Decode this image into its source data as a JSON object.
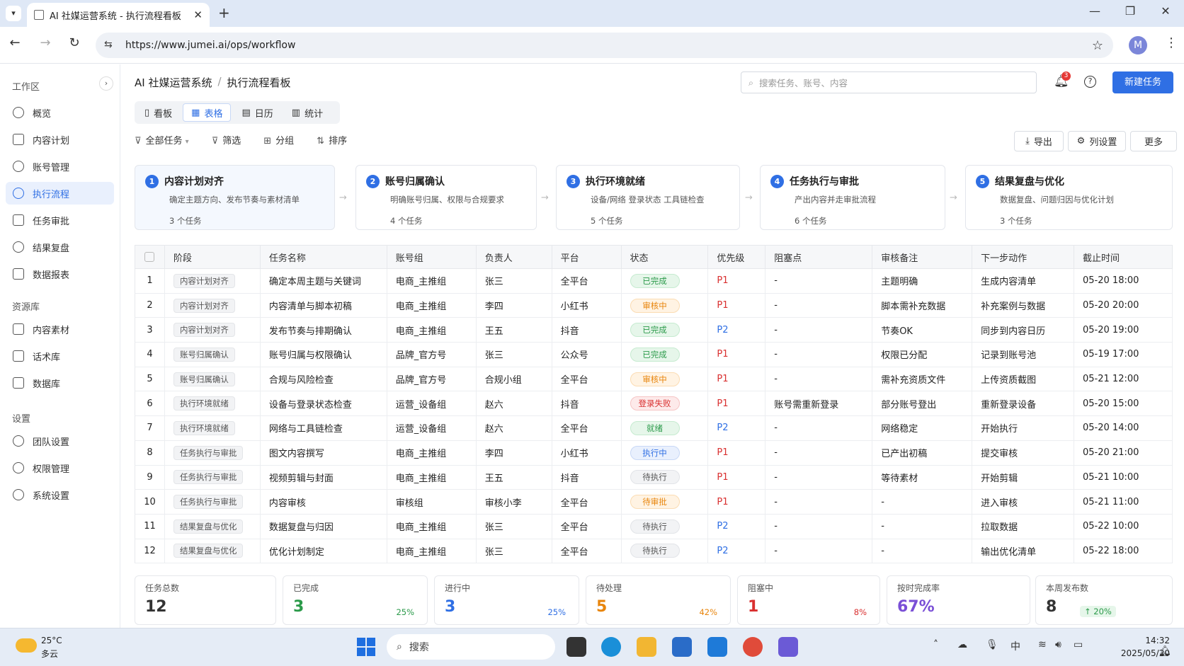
{
  "browser": {
    "tab_title": "AI 社媒运营系统 - 执行流程看板",
    "url": "https://www.jumei.ai/ops/workflow",
    "avatar_letter": "M"
  },
  "sidebar": {
    "workspace_label": "工作区",
    "workspace_items": [
      "概览",
      "内容计划",
      "账号管理",
      "执行流程",
      "任务审批",
      "结果复盘",
      "数据报表"
    ],
    "active_item": "执行流程",
    "library_label": "资源库",
    "library_items": [
      "内容素材",
      "话术库",
      "数据库"
    ],
    "settings_label": "设置",
    "settings_items": [
      "团队设置",
      "权限管理",
      "系统设置"
    ]
  },
  "header": {
    "breadcrumb_root": "AI 社媒运营系统",
    "breadcrumb_sep": "/",
    "breadcrumb_current": "执行流程看板",
    "search_placeholder": "搜索任务、账号、内容",
    "notification_count": "3",
    "new_task_label": "新建任务"
  },
  "view_tabs": [
    "看板",
    "表格",
    "日历",
    "统计"
  ],
  "active_view": "表格",
  "toolbar": {
    "filter_all": "全部任务",
    "filter": "筛选",
    "group": "分组",
    "sort": "排序",
    "export": "导出",
    "column_settings": "列设置",
    "more": "更多"
  },
  "stages": [
    {
      "num": "1",
      "title": "内容计划对齐",
      "desc": "确定主题方向、发布节奏与素材清单",
      "count": "3 个任务"
    },
    {
      "num": "2",
      "title": "账号归属确认",
      "desc": "明确账号归属、权限与合规要求",
      "count": "4 个任务"
    },
    {
      "num": "3",
      "title": "执行环境就绪",
      "desc": "设备/网络 登录状态 工具链检查",
      "count": "5 个任务"
    },
    {
      "num": "4",
      "title": "任务执行与审批",
      "desc": "产出内容并走审批流程",
      "count": "6 个任务"
    },
    {
      "num": "5",
      "title": "结果复盘与优化",
      "desc": "数据复盘、问题归因与优化计划",
      "count": "3 个任务"
    }
  ],
  "table": {
    "columns": [
      "阶段",
      "任务名称",
      "账号组",
      "负责人",
      "平台",
      "状态",
      "优先级",
      "阻塞点",
      "审核备注",
      "下一步动作",
      "截止时间"
    ],
    "rows": [
      [
        "1",
        "内容计划对齐",
        "确定本周主题与关键词",
        "电商_主推组",
        "张三",
        "全平台",
        "已完成",
        "P1",
        "-",
        "主题明确",
        "生成内容清单",
        "05-20 18:00"
      ],
      [
        "2",
        "内容计划对齐",
        "内容清单与脚本初稿",
        "电商_主推组",
        "李四",
        "小红书",
        "审核中",
        "P1",
        "-",
        "脚本需补充数据",
        "补充案例与数据",
        "05-20 20:00"
      ],
      [
        "3",
        "内容计划对齐",
        "发布节奏与排期确认",
        "电商_主推组",
        "王五",
        "抖音",
        "已完成",
        "P2",
        "-",
        "节奏OK",
        "同步到内容日历",
        "05-20 19:00"
      ],
      [
        "4",
        "账号归属确认",
        "账号归属与权限确认",
        "品牌_官方号",
        "张三",
        "公众号",
        "已完成",
        "P1",
        "-",
        "权限已分配",
        "记录到账号池",
        "05-19 17:00"
      ],
      [
        "5",
        "账号归属确认",
        "合规与风险检查",
        "品牌_官方号",
        "合规小组",
        "全平台",
        "审核中",
        "P1",
        "-",
        "需补充资质文件",
        "上传资质截图",
        "05-21 12:00"
      ],
      [
        "6",
        "执行环境就绪",
        "设备与登录状态检查",
        "运营_设备组",
        "赵六",
        "抖音",
        "登录失败",
        "P1",
        "账号需重新登录",
        "部分账号登出",
        "重新登录设备",
        "05-20 15:00"
      ],
      [
        "7",
        "执行环境就绪",
        "网络与工具链检查",
        "运营_设备组",
        "赵六",
        "全平台",
        "就绪",
        "P2",
        "-",
        "网络稳定",
        "开始执行",
        "05-20 14:00"
      ],
      [
        "8",
        "任务执行与审批",
        "图文内容撰写",
        "电商_主推组",
        "李四",
        "小红书",
        "执行中",
        "P1",
        "-",
        "已产出初稿",
        "提交审核",
        "05-20 21:00"
      ],
      [
        "9",
        "任务执行与审批",
        "视频剪辑与封面",
        "电商_主推组",
        "王五",
        "抖音",
        "待执行",
        "P1",
        "-",
        "等待素材",
        "开始剪辑",
        "05-21 10:00"
      ],
      [
        "10",
        "任务执行与审批",
        "内容审核",
        "审核组",
        "审核小李",
        "全平台",
        "待审批",
        "P1",
        "-",
        "-",
        "进入审核",
        "05-21 11:00"
      ],
      [
        "11",
        "结果复盘与优化",
        "数据复盘与归因",
        "电商_主推组",
        "张三",
        "全平台",
        "待执行",
        "P2",
        "-",
        "-",
        "拉取数据",
        "05-22 10:00"
      ],
      [
        "12",
        "结果复盘与优化",
        "优化计划制定",
        "电商_主推组",
        "张三",
        "全平台",
        "待执行",
        "P2",
        "-",
        "-",
        "输出优化清单",
        "05-22 18:00"
      ]
    ]
  },
  "stats": [
    {
      "label": "任务总数",
      "value": "12",
      "pct": "",
      "color": "#333333"
    },
    {
      "label": "已完成",
      "value": "3",
      "pct": "25%",
      "color": "#2b9a4a"
    },
    {
      "label": "进行中",
      "value": "3",
      "pct": "25%",
      "color": "#2f6fe4"
    },
    {
      "label": "待处理",
      "value": "5",
      "pct": "42%",
      "color": "#e8850c"
    },
    {
      "label": "阻塞中",
      "value": "1",
      "pct": "8%",
      "color": "#d93030"
    },
    {
      "label": "按时完成率",
      "value": "67%",
      "pct": "",
      "color": "#7a4fd6"
    },
    {
      "label": "本周发布数",
      "value": "8",
      "pct": "↑ 20%",
      "color": "#333333"
    }
  ],
  "taskbar": {
    "temp": "25°C",
    "condition": "多云",
    "search": "搜索",
    "ime": "中",
    "time": "14:32",
    "date": "2025/05/20"
  },
  "icons": [
    "search-icon",
    "bell-icon",
    "help-icon",
    "filter-icon",
    "group-icon",
    "sort-icon",
    "export-icon",
    "settings-icon"
  ]
}
